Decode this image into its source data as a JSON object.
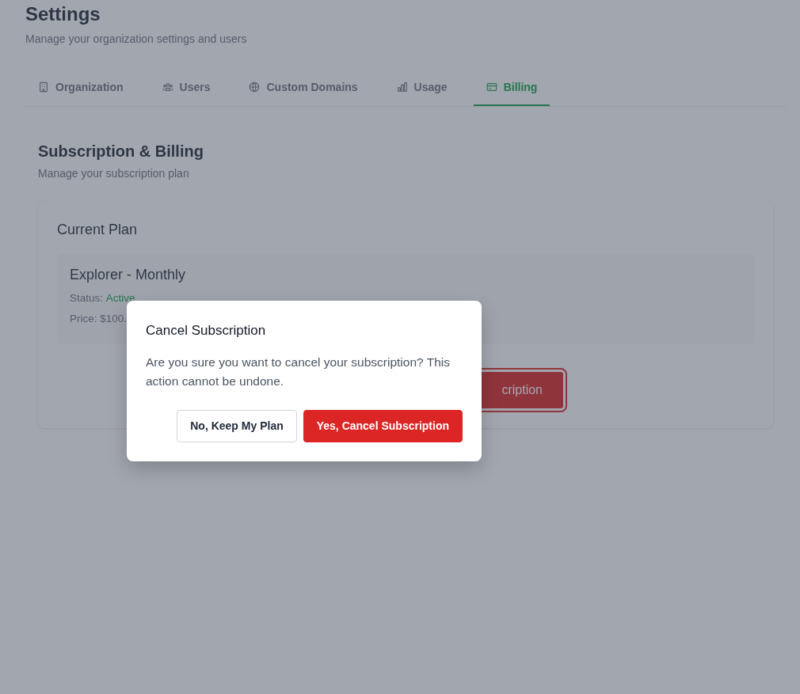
{
  "header": {
    "title": "Settings",
    "subtitle": "Manage your organization settings and users"
  },
  "tabs": [
    {
      "label": "Organization",
      "selected": false
    },
    {
      "label": "Users",
      "selected": false
    },
    {
      "label": "Custom Domains",
      "selected": false
    },
    {
      "label": "Usage",
      "selected": false
    },
    {
      "label": "Billing",
      "selected": true
    }
  ],
  "section": {
    "title": "Subscription & Billing",
    "subtitle": "Manage your subscription plan"
  },
  "current_plan": {
    "title": "Current Plan",
    "plan_name": "Explorer - Monthly",
    "status_label": "Status:",
    "status": "Active",
    "price": "Price: $100.",
    "cancel_button": "cription"
  },
  "dialog": {
    "title": "Cancel Subscription",
    "message": "Are you sure you want to cancel your subscription? This action cannot be undone.",
    "buttons": [
      {
        "label": "No, Keep My Plan",
        "kind": "secondary"
      },
      {
        "label": "Yes, Cancel Subscription",
        "kind": "danger"
      }
    ]
  }
}
